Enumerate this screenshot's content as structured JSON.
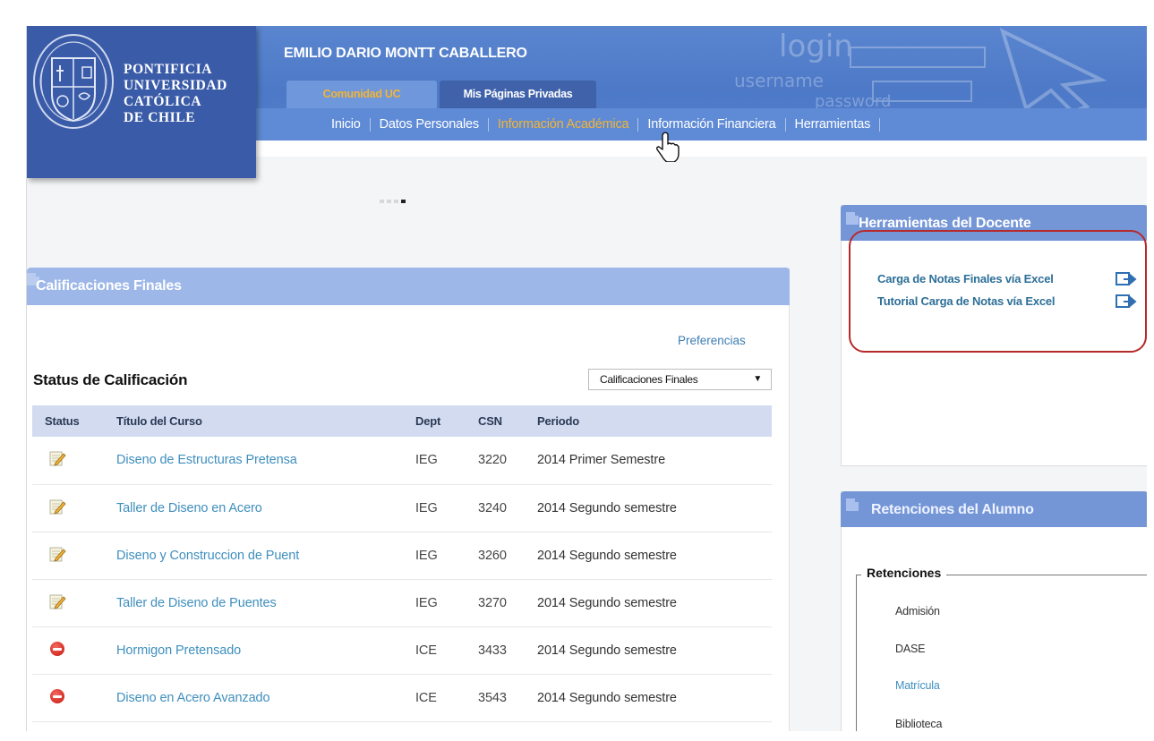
{
  "header": {
    "university_lines": [
      "PONTIFICIA",
      "UNIVERSIDAD",
      "CATÓLICA",
      "DE CHILE"
    ],
    "user_name": "EMILIO DARIO MONTT CABALLERO",
    "top_tabs": [
      {
        "label": "Comunidad UC",
        "active": true
      },
      {
        "label": "Mis Páginas Privadas",
        "active": false
      }
    ],
    "nav": [
      {
        "label": "Inicio",
        "active": false
      },
      {
        "label": "Datos Personales",
        "active": false
      },
      {
        "label": "Información Académica",
        "active": true
      },
      {
        "label": "Información Financiera",
        "active": false
      },
      {
        "label": "Herramientas",
        "active": false
      }
    ],
    "background_words": [
      "login",
      "username",
      "password"
    ]
  },
  "carousel": {
    "dot_count": 4,
    "active_index": 3
  },
  "calificaciones": {
    "panel_title": "Calificaciones Finales",
    "preferences_link": "Preferencias",
    "status_title": "Status de Calificación",
    "select_value": "Calificaciones Finales",
    "columns": [
      "Status",
      "Título del Curso",
      "Dept",
      "CSN",
      "Periodo"
    ],
    "rows": [
      {
        "status": "edit-icon",
        "course": "Diseno de Estructuras Pretensa",
        "dept": "IEG",
        "csn": "3220",
        "period": "2014 Primer Semestre"
      },
      {
        "status": "edit-icon",
        "course": "Taller de Diseno en Acero",
        "dept": "IEG",
        "csn": "3240",
        "period": "2014 Segundo semestre"
      },
      {
        "status": "edit-icon",
        "course": "Diseno y Construccion de Puent",
        "dept": "IEG",
        "csn": "3260",
        "period": "2014 Segundo semestre"
      },
      {
        "status": "edit-icon",
        "course": "Taller de Diseno de Puentes",
        "dept": "IEG",
        "csn": "3270",
        "period": "2014 Segundo semestre"
      },
      {
        "status": "stop-icon",
        "course": "Hormigon Pretensado",
        "dept": "ICE",
        "csn": "3433",
        "period": "2014 Segundo semestre"
      },
      {
        "status": "stop-icon",
        "course": "Diseno en Acero Avanzado",
        "dept": "ICE",
        "csn": "3543",
        "period": "2014 Segundo semestre"
      }
    ]
  },
  "herramientas": {
    "panel_title": "Herramientas del Docente",
    "links": [
      {
        "label": "Carga de Notas Finales vía Excel",
        "icon": "export-icon"
      },
      {
        "label": "Tutorial Carga de Notas vía Excel",
        "icon": "export-icon"
      }
    ]
  },
  "retenciones": {
    "panel_title": "Retenciones del Alumno",
    "legend": "Retenciones",
    "items": [
      {
        "label": "Admisión",
        "is_link": false
      },
      {
        "label": "DASE",
        "is_link": false
      },
      {
        "label": "Matrícula",
        "is_link": true
      },
      {
        "label": "Biblioteca",
        "is_link": false
      }
    ]
  },
  "colors": {
    "header_blue": "#4d79c7",
    "accent_orange": "#f2b437",
    "panel_header": "#9db7e8",
    "link_blue": "#3f8fbe",
    "highlight_red": "#b62a2a"
  }
}
